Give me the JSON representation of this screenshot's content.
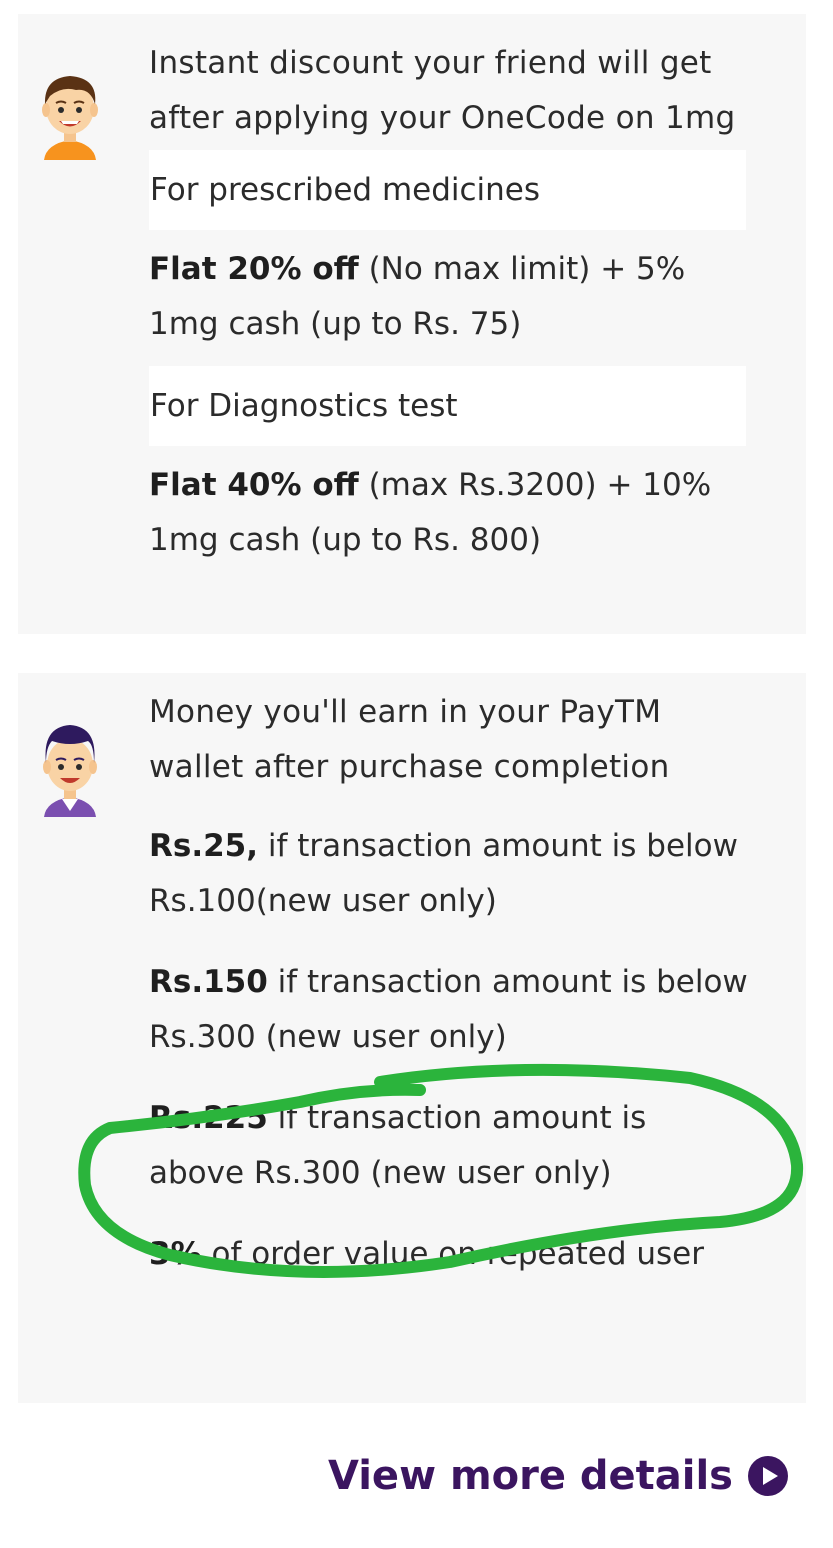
{
  "friend_card": {
    "heading": "Instant discount your friend will get after applying your OneCode on 1mg",
    "offers": [
      {
        "label": "For prescribed medicines",
        "bold": "Flat 20% off",
        "rest": " (No max limit) + 5% 1mg cash (up to Rs. 75)"
      },
      {
        "label": "For Diagnostics test",
        "bold": "Flat 40% off",
        "rest": " (max Rs.3200) + 10% 1mg cash (up to Rs. 800)"
      }
    ]
  },
  "earn_card": {
    "heading": "Money you'll earn in your PayTM wallet after purchase completion",
    "items": [
      {
        "bold": "Rs.25,",
        "rest": " if transaction amount is below Rs.100(new user only)"
      },
      {
        "bold": "Rs.150",
        "rest": " if transaction amount is below Rs.300 (new user only)"
      },
      {
        "bold": "Rs.225",
        "rest": " if transaction amount is above Rs.300 (new user only)"
      },
      {
        "bold": "3%",
        "rest": " of order value on repeated user"
      }
    ]
  },
  "footer": {
    "link_label": "View more details",
    "link_color": "#3b1560"
  },
  "colors": {
    "card_bg": "#f7f7f7",
    "highlight_circle": "#2bb43c"
  },
  "icons": {
    "friend_avatar": "boy-orange-shirt-avatar",
    "earner_avatar": "man-purple-shirt-avatar",
    "link_arrow": "play-circle-icon"
  }
}
